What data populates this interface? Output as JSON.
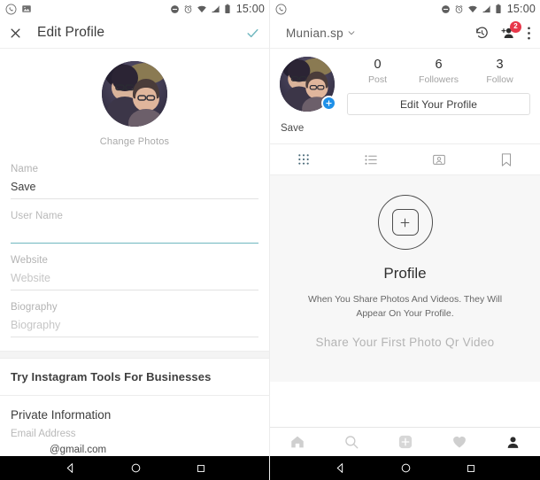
{
  "status_bar": {
    "time": "15:00",
    "left_icons": [
      "whatsapp-icon",
      "screenshot-image-icon"
    ],
    "right_icons": [
      "do-not-disturb-icon",
      "alarm-icon",
      "wifi-icon",
      "signal-icon",
      "battery-icon"
    ]
  },
  "left_panel": {
    "header": {
      "close_label": "X",
      "title": "Edit Profile",
      "confirm_icon": "checkmark-icon",
      "accent_color": "#6fb7bf"
    },
    "avatar": {
      "change_photos_label": "Change Photos"
    },
    "fields": [
      {
        "label": "Name",
        "value": "Save",
        "placeholder": "",
        "focused": false
      },
      {
        "label": "User Name",
        "value": "",
        "placeholder": "",
        "focused": true
      },
      {
        "label": "Website",
        "value": "",
        "placeholder": "Website",
        "focused": false
      },
      {
        "label": "Biography",
        "value": "",
        "placeholder": "Biography",
        "focused": false
      }
    ],
    "business_row": "Try Instagram Tools For Businesses",
    "private_section": {
      "title": "Private Information",
      "email_label": "Email Address",
      "email_value": "@gmail.com"
    }
  },
  "right_panel": {
    "header": {
      "username": "Munian.sp",
      "dropdown_icon": "chevron-down-icon",
      "history_icon": "history-clock-icon",
      "add_person_icon": "add-person-icon",
      "add_person_badge": "2",
      "badge_color": "#e8374a",
      "menu_icon": "overflow-menu-icon"
    },
    "profile": {
      "add_photo_icon": "plus-circle-icon",
      "add_photo_color": "#1f90e8",
      "stats": [
        {
          "count": "0",
          "label": "Post"
        },
        {
          "count": "6",
          "label": "Followers"
        },
        {
          "count": "3",
          "label": "Follow"
        }
      ],
      "edit_button": "Edit Your Profile",
      "display_name": "Save"
    },
    "tabs": [
      {
        "icon": "grid-icon",
        "active": true
      },
      {
        "icon": "list-icon",
        "active": false
      },
      {
        "icon": "tagged-photos-icon",
        "active": false
      },
      {
        "icon": "bookmark-icon",
        "active": false
      }
    ],
    "empty_state": {
      "icon": "plus-square-in-circle-icon",
      "title": "Profile",
      "description": "When You Share Photos And Videos. They Will Appear On Your Profile.",
      "cta": "Share Your First Photo Qr Video"
    },
    "bottom_nav": [
      {
        "icon": "home-icon",
        "active": false
      },
      {
        "icon": "search-icon",
        "active": false
      },
      {
        "icon": "add-post-icon",
        "active": false
      },
      {
        "icon": "heart-activity-icon",
        "active": false
      },
      {
        "icon": "profile-person-icon",
        "active": true
      }
    ]
  },
  "android_nav": [
    {
      "icon": "back-triangle-icon"
    },
    {
      "icon": "home-circle-icon"
    },
    {
      "icon": "recents-square-icon"
    }
  ]
}
